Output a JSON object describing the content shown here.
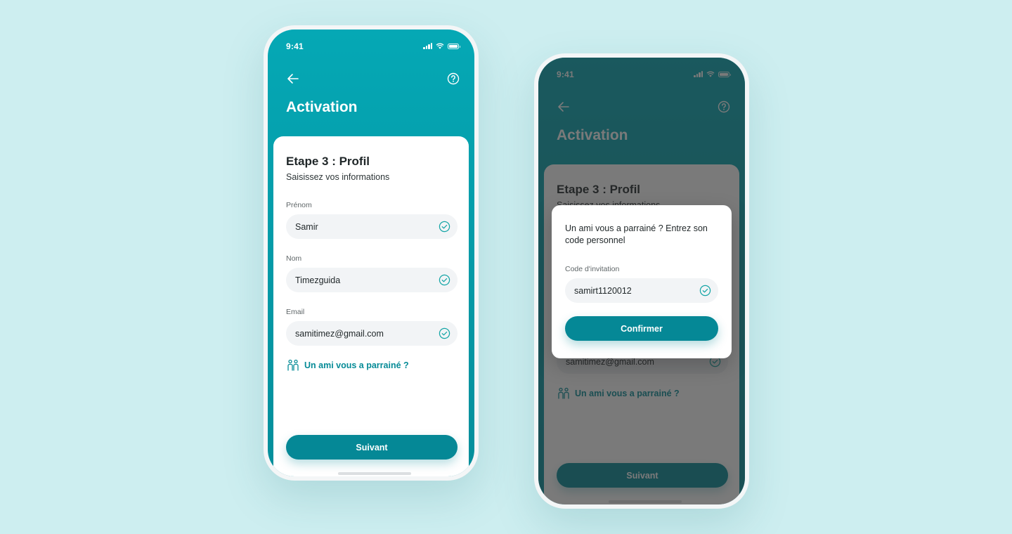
{
  "status": {
    "time": "9:41"
  },
  "header": {
    "title": "Activation"
  },
  "form": {
    "step_title": "Etape 3 : Profil",
    "step_subtitle": "Saisissez vos informations",
    "fields": [
      {
        "label": "Prénom",
        "value": "Samir"
      },
      {
        "label": "Nom",
        "value": "Timezguida"
      },
      {
        "label": "Email",
        "value": "samitimez@gmail.com"
      }
    ],
    "referral_link": "Un ami vous a parrainé ?",
    "next_button": "Suivant"
  },
  "modal": {
    "text": "Un ami vous a parrainé ? Entrez son code personnel",
    "field_label": "Code d'invitation",
    "field_value": "samirt1120012",
    "confirm_button": "Confirmer"
  },
  "icons": {
    "back": "arrow-left-icon",
    "help": "question-circle-icon",
    "check": "check-circle-icon",
    "referral": "people-icon"
  },
  "colors": {
    "background": "#cdeef0",
    "header_gradient_top": "#05a8b5",
    "header_gradient_bottom": "#048e9b",
    "accent": "#058896",
    "link": "#068b97",
    "check": "#14a5a6"
  }
}
